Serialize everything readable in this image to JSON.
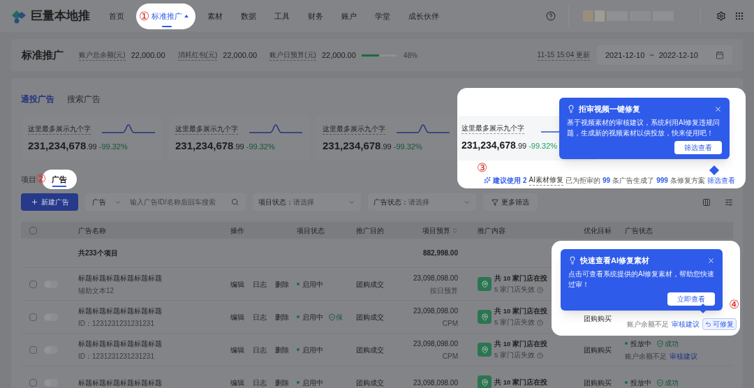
{
  "nav": {
    "logo": "巨量本地推",
    "annotation": "①",
    "items": [
      {
        "label": "首页",
        "selected": false
      },
      {
        "label": "标准推广",
        "selected": true
      },
      {
        "label": "素材",
        "selected": false
      },
      {
        "label": "数据",
        "selected": false
      },
      {
        "label": "工具",
        "selected": false
      },
      {
        "label": "财务",
        "selected": false
      },
      {
        "label": "账户",
        "selected": false
      },
      {
        "label": "学堂",
        "selected": false
      },
      {
        "label": "成长伙伴",
        "selected": false
      }
    ]
  },
  "summary": {
    "title": "标准推广",
    "stats": [
      {
        "label": "账户总余额(元)",
        "value": "22,000.00"
      },
      {
        "label": "消耗红包(元)",
        "value": "22,000.00"
      },
      {
        "label": "账户日预算(元)",
        "value": "22,000.00"
      }
    ],
    "budget_bar": {
      "level": 0.5,
      "reading": "48%"
    },
    "updated": "11-15 15:04 更新",
    "date_start": "2021-12-10",
    "date_separator": "~",
    "date_end": "2022-12-10"
  },
  "channel_tabs": [
    {
      "label": "通投广告",
      "selected": true
    },
    {
      "label": "搜索广告",
      "selected": false
    }
  ],
  "metrics": [
    {
      "label": "这里最多展示九个字",
      "value": "231,234,678",
      "decimals": ".99",
      "change": "-99.32%"
    },
    {
      "label": "这里最多展示九个字",
      "value": "231,234,678",
      "decimals": ".99",
      "change": "-99.32%"
    },
    {
      "label": "这里最多展示九个字",
      "value": "231,234,678",
      "decimals": ".99",
      "change": "-99.32%"
    },
    {
      "label": "这里最多展示九个字",
      "value": "231,234,678",
      "decimals": ".99",
      "change": "-99.32%"
    }
  ],
  "repair_tip": {
    "annotation": "③",
    "title": "拒审视频一键修复",
    "body": "基于视频素材的审核建议，系统利用AI修复违规问题，生成新的视频素材以供投放，快来使用吧！",
    "button": "筛选查看",
    "hint": [
      {
        "kind": "badge",
        "text": "建议使用"
      },
      {
        "kind": "number",
        "text": "2"
      },
      {
        "kind": "term",
        "text": "AI素材修复"
      },
      {
        "kind": "text",
        "text": "已为拒审的"
      },
      {
        "kind": "number",
        "text": "99"
      },
      {
        "kind": "text",
        "text": "条广告生成了"
      },
      {
        "kind": "number",
        "text": "999"
      },
      {
        "kind": "text",
        "text": "条修复方案"
      },
      {
        "kind": "link",
        "text": "筛选查看"
      }
    ]
  },
  "level_tabs": {
    "annotation": "②",
    "items": [
      {
        "label": "项目",
        "selected": false
      },
      {
        "label": "广告",
        "selected": true
      }
    ]
  },
  "toolbar": {
    "new_button": "新建广告",
    "scope_select": "广告",
    "search_placeholder": "输入广告ID/名称后回车搜索",
    "filters": [
      {
        "label": "项目状态：",
        "placeholder": "请选择"
      },
      {
        "label": "广告状态：",
        "placeholder": "请选择"
      }
    ],
    "more_filters": "更多筛选"
  },
  "table": {
    "header_checked": false,
    "columns": [
      "广告名称",
      "操作",
      "项目状态",
      "推广目的",
      "项目预算",
      "推广内容",
      "优化目标",
      "广告状态"
    ],
    "total_row": {
      "label": "共233个项目",
      "budget": "882,998.00"
    },
    "rows": [
      {
        "checked": false,
        "enabled": false,
        "title": "标题标题标题标题标题标题",
        "subtitle": "辅助文本12",
        "actions": [
          "编辑",
          "日志",
          "删除"
        ],
        "project_status": "启用中",
        "purpose": "团购成交",
        "budget": "23,098,098.00",
        "budget_type": "按日预算",
        "content_main": "共 10 家门店在投",
        "content_sub": "5 家门店失效"
      },
      {
        "checked": false,
        "enabled": false,
        "title": "标题标题标题标题标题标题",
        "subtitle": "ID：1231231231231231",
        "actions": [
          "编辑",
          "日志",
          "删除"
        ],
        "project_status": "启用中",
        "status_badge": "保",
        "purpose": "团购成交",
        "budget": "23,098,098.00",
        "budget_type": "CPM",
        "content_main": "共 10 家门店在投",
        "content_sub": "5 家门店失效"
      },
      {
        "checked": false,
        "enabled": false,
        "title": "标题标题标题标题标题标题",
        "subtitle": "ID：1231231231231231",
        "actions": [
          "编辑",
          "日志",
          "删除"
        ],
        "project_status": "启用中",
        "purpose": "团购成交",
        "budget": "23,098,098.00",
        "budget_type": "CPM",
        "content_main": "共 10 家门店在投",
        "content_sub": "5 家门店失效",
        "goal": "团购购买",
        "ad_status": "投放中",
        "ad_status_badge": "成功",
        "ad_note": "账户余额不足",
        "ad_link": "审核建议"
      },
      {
        "checked": false,
        "enabled": false,
        "title": "标题标题标题标题标题标题",
        "actions": [
          "编辑",
          "日志",
          "删除"
        ],
        "project_status": "启用中",
        "purpose": "团购成交",
        "budget": "23,098,098.00",
        "content_main": "共 10 家门店在投",
        "goal": "团购购买",
        "ad_status": "投放中",
        "ad_status_badge": "成功"
      }
    ]
  },
  "material_tip": {
    "annotation": "④",
    "title": "快速查看AI修复素材",
    "body": "点击可查看系统提供的AI修复素材，帮助您快速过审！",
    "button": "立即查看",
    "goal": "团购购买",
    "ad_note": "账户余额不足",
    "ad_link": "审核建议",
    "repair_tag": "可修复"
  }
}
